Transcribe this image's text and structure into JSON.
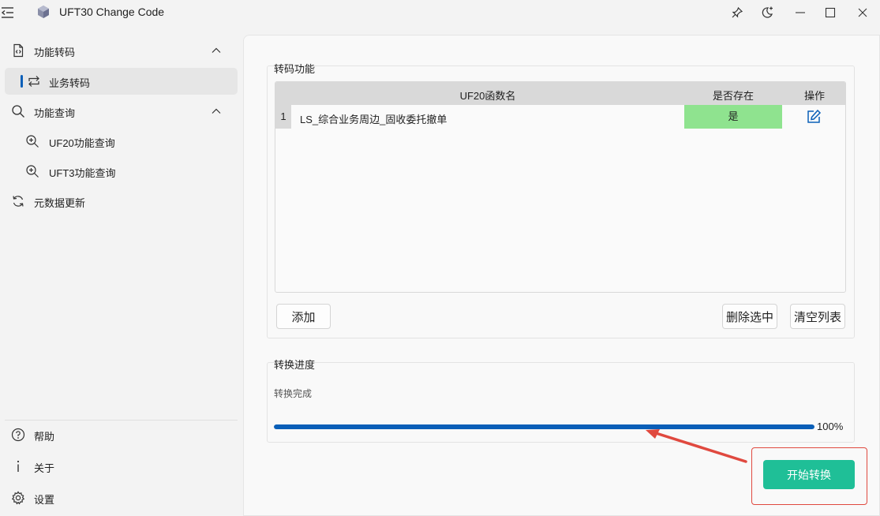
{
  "window": {
    "title": "UFT30 Change Code"
  },
  "sidebar": {
    "groups": [
      {
        "label": "功能转码",
        "expanded": true,
        "items": [
          {
            "label": "业务转码",
            "selected": true
          }
        ]
      },
      {
        "label": "功能查询",
        "expanded": true,
        "items": [
          {
            "label": "UF20功能查询"
          },
          {
            "label": "UFT3功能查询"
          }
        ]
      }
    ],
    "metadata_update": {
      "label": "元数据更新"
    },
    "footer": {
      "help": "帮助",
      "about": "关于",
      "settings": "设置"
    }
  },
  "transcode": {
    "group_title": "转码功能",
    "table": {
      "columns": [
        "UF20函数名",
        "是否存在",
        "操作"
      ],
      "rows": [
        {
          "index": "1",
          "name": "LS_综合业务周边_固收委托撤单",
          "exists": "是"
        }
      ]
    },
    "buttons": {
      "add": "添加",
      "delete_selected": "删除选中",
      "clear_list": "清空列表"
    }
  },
  "progress": {
    "group_title": "转换进度",
    "status": "转换完成",
    "value": 1.0,
    "percent_label": "100%"
  },
  "start_button": {
    "label": "开始转换"
  },
  "colors": {
    "accent": "#0a5fb8",
    "exists_green": "#8fe38f",
    "start_button": "#1fbf97",
    "annotation_red": "#e0493f"
  }
}
